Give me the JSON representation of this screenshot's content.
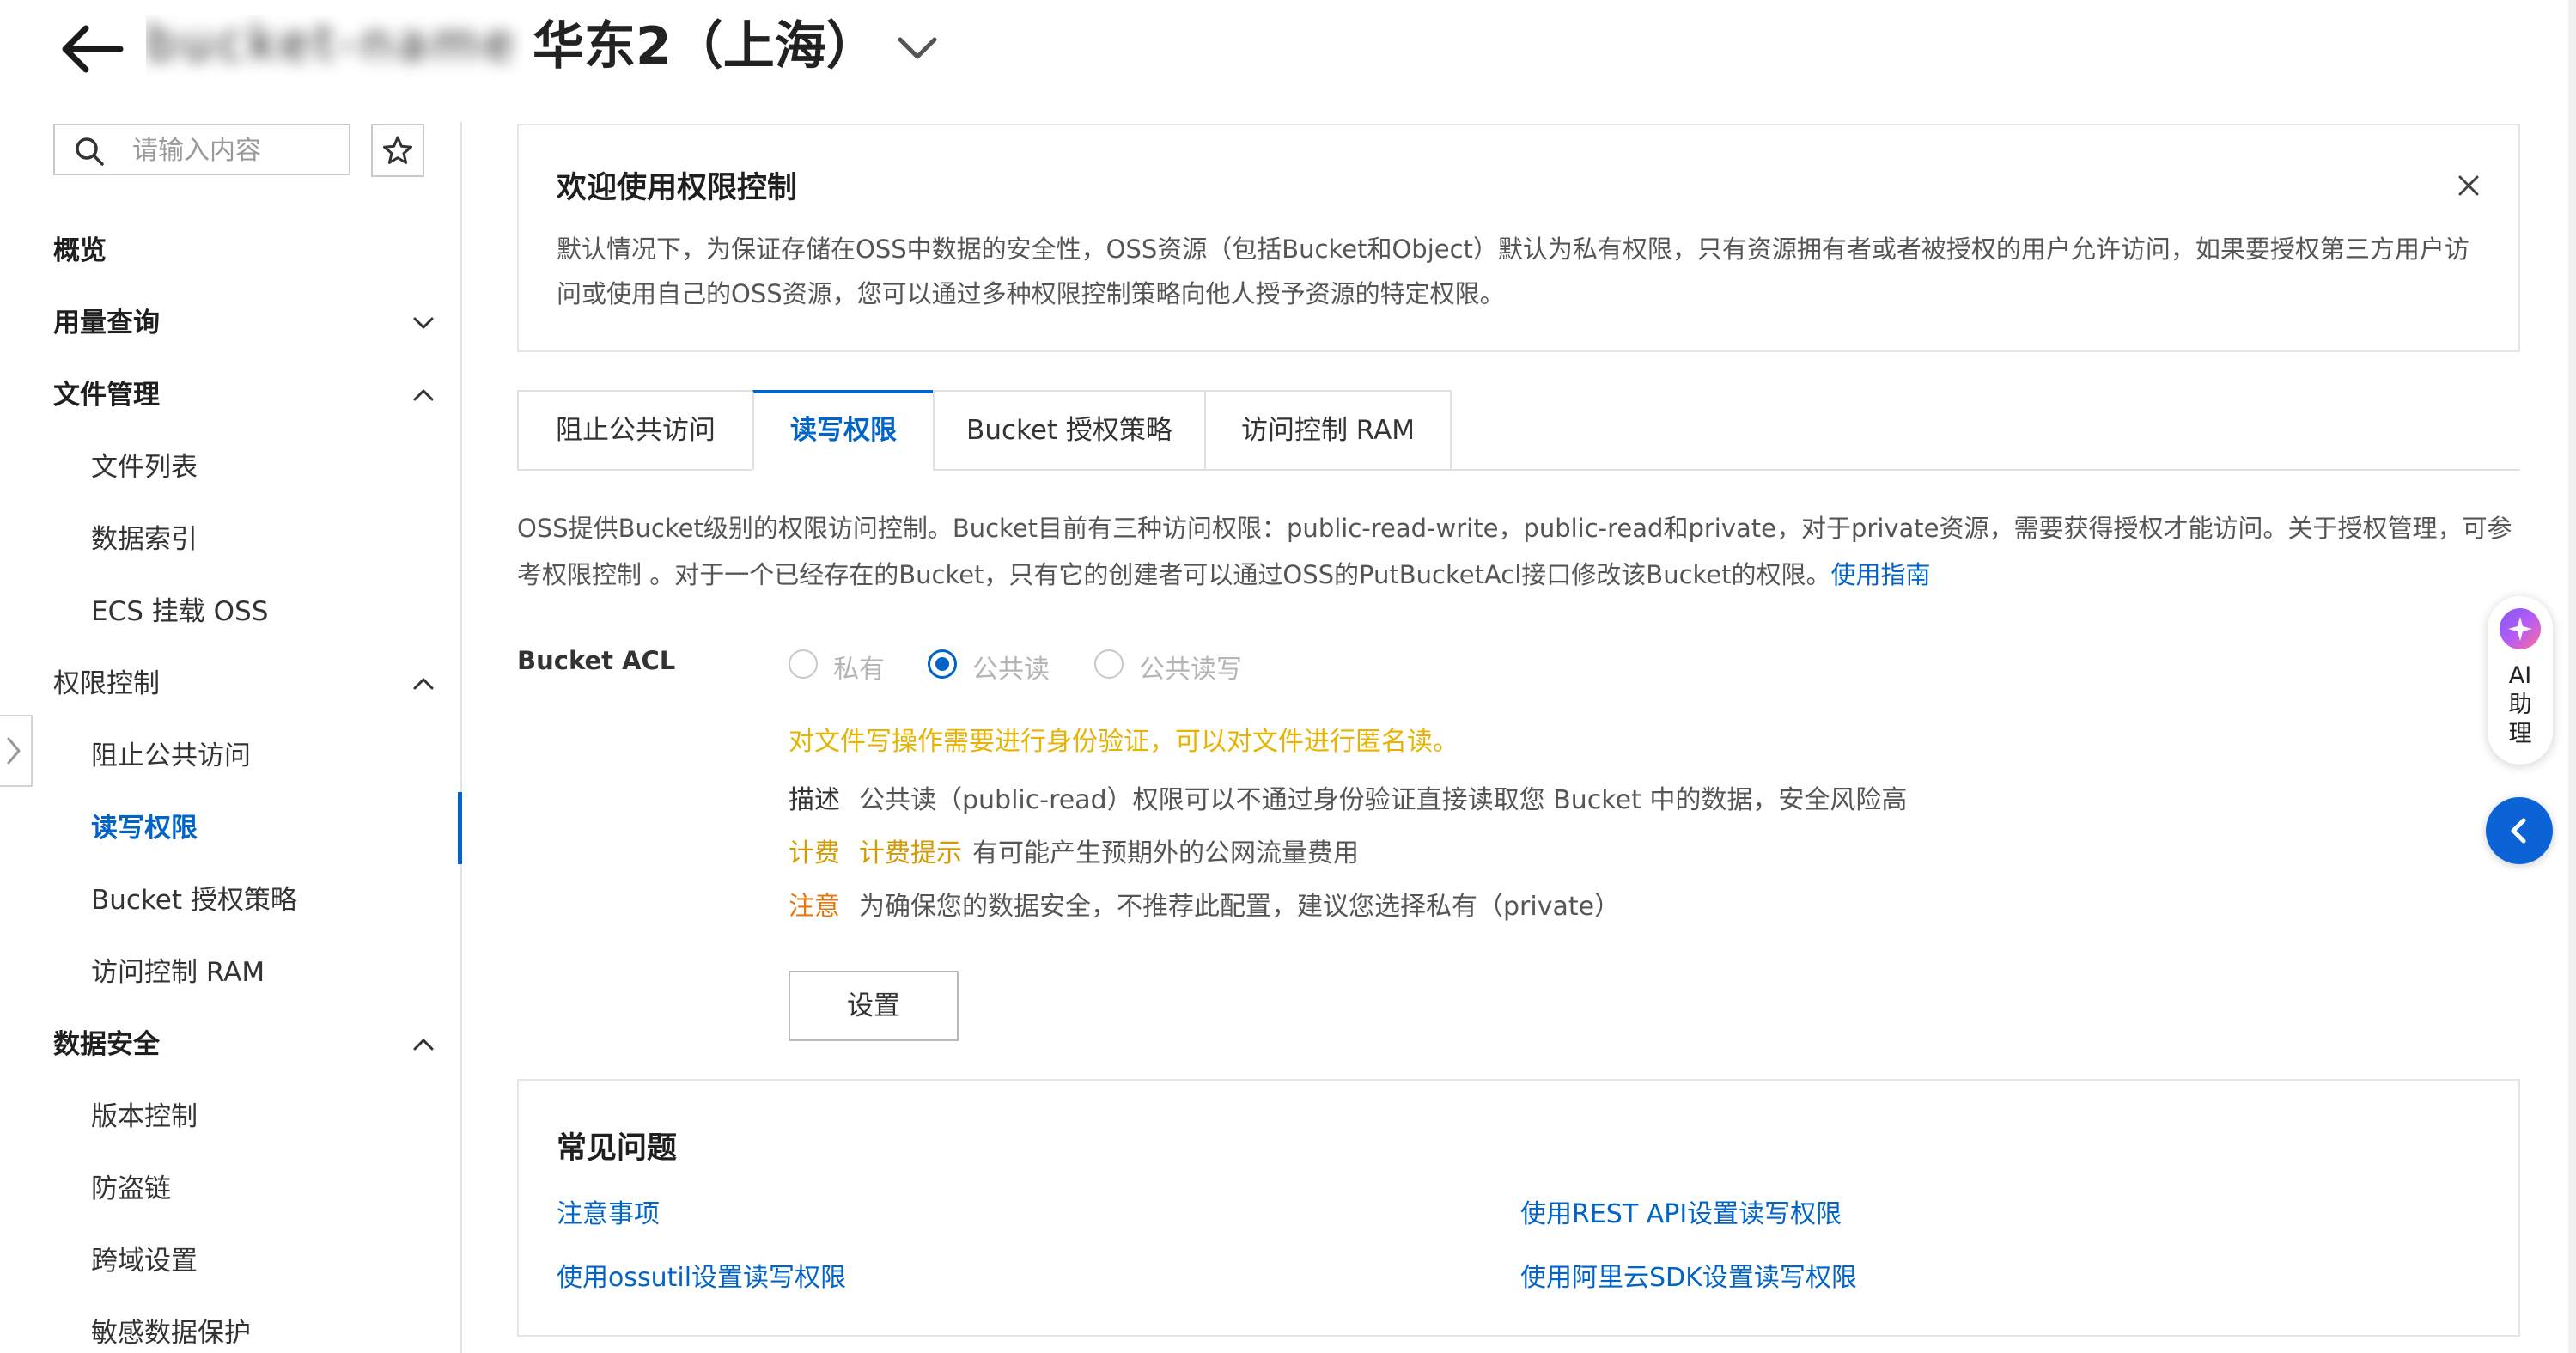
{
  "header": {
    "back_icon": "arrow-left-icon",
    "blurred_bucket_name": "bucket-name",
    "region": "华东2（上海）",
    "region_dropdown_icon": "chevron-down-icon"
  },
  "sidebar": {
    "search": {
      "placeholder": "请输入内容",
      "value": ""
    },
    "favorite_icon": "star-icon",
    "items": [
      {
        "label": "概览"
      },
      {
        "label": "用量查询"
      },
      {
        "label": "文件管理"
      },
      {
        "label": "文件列表"
      },
      {
        "label": "数据索引"
      },
      {
        "label": "ECS 挂载 OSS"
      },
      {
        "label": "权限控制"
      },
      {
        "label": "阻止公共访问"
      },
      {
        "label": "读写权限"
      },
      {
        "label": "Bucket 授权策略"
      },
      {
        "label": "访问控制 RAM"
      },
      {
        "label": "数据安全"
      },
      {
        "label": "版本控制"
      },
      {
        "label": "防盗链"
      },
      {
        "label": "跨域设置"
      },
      {
        "label": "敏感数据保护"
      }
    ]
  },
  "welcome": {
    "title": "欢迎使用权限控制",
    "description": "默认情况下，为保证存储在OSS中数据的安全性，OSS资源（包括Bucket和Object）默认为私有权限，只有资源拥有者或者被授权的用户允许访问，如果要授权第三方用户访问或使用自己的OSS资源，您可以通过多种权限控制策略向他人授予资源的特定权限。"
  },
  "tabs": [
    {
      "label": "阻止公共访问"
    },
    {
      "label": "读写权限"
    },
    {
      "label": "Bucket 授权策略"
    },
    {
      "label": "访问控制 RAM"
    }
  ],
  "intro": {
    "text": "OSS提供Bucket级别的权限访问控制。Bucket目前有三种访问权限：public-read-write，public-read和private，对于private资源，需要获得授权才能访问。关于授权管理，可参考权限控制 。对于一个已经存在的Bucket，只有它的创建者可以通过OSS的PutBucketAcl接口修改该Bucket的权限。",
    "link": "使用指南"
  },
  "acl": {
    "label": "Bucket ACL",
    "options": [
      {
        "label": "私有",
        "checked": false
      },
      {
        "label": "公共读",
        "checked": true
      },
      {
        "label": "公共读写",
        "checked": false
      }
    ],
    "warning": "对文件写操作需要进行身份验证，可以对文件进行匿名读。",
    "description_key": "描述",
    "description": "公共读（public-read）权限可以不通过身份验证直接读取您 Bucket 中的数据，安全风险高",
    "billing_key": "计费",
    "billing_hint": "计费提示",
    "billing": "有可能产生预期外的公网流量费用",
    "note_key": "注意",
    "note": "为确保您的数据安全，不推荐此配置，建议您选择私有（private）",
    "set_button": "设置"
  },
  "faq": {
    "title": "常见问题",
    "links": [
      "注意事项",
      "使用REST API设置读写权限",
      "使用ossutil设置读写权限",
      "使用阿里云SDK设置读写权限"
    ]
  },
  "ai_assistant": {
    "label_line1": "AI",
    "label_line2": "助",
    "label_line3": "理",
    "icon": "ai-sparkle-icon"
  },
  "fold_icon": "chevron-left-icon",
  "colors": {
    "primary": "#0064c8",
    "warning": "#e8b300",
    "note": "#e4780d"
  }
}
